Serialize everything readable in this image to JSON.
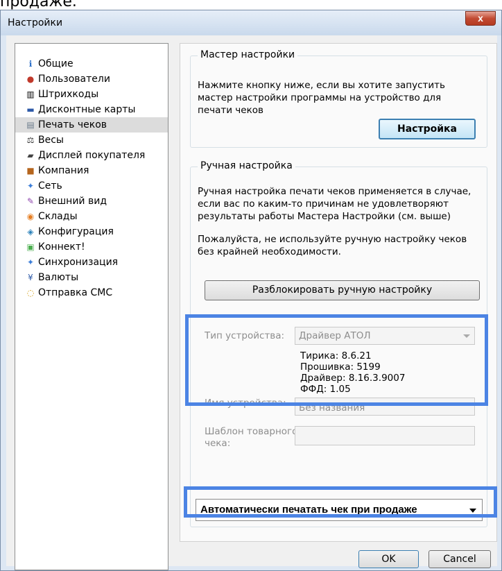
{
  "top_snippet": "продаже.",
  "window": {
    "title": "Настройки",
    "close_label": "x"
  },
  "sidebar": {
    "items": [
      {
        "label": "Общие",
        "icon": "info-icon",
        "glyph": "ℹ",
        "color": "#2a6fc9"
      },
      {
        "label": "Пользователи",
        "icon": "users-icon",
        "glyph": "●",
        "color": "#c0392b"
      },
      {
        "label": "Штрихкоды",
        "icon": "barcode-icon",
        "glyph": "▥",
        "color": "#000000"
      },
      {
        "label": "Дисконтные карты",
        "icon": "card-icon",
        "glyph": "▬",
        "color": "#2e5aa8"
      },
      {
        "label": "Печать чеков",
        "icon": "printer-icon",
        "glyph": "▤",
        "color": "#6a7a8a",
        "selected": true
      },
      {
        "label": "Весы",
        "icon": "scales-icon",
        "glyph": "⚖",
        "color": "#333333"
      },
      {
        "label": "Дисплей покупателя",
        "icon": "display-icon",
        "glyph": "▰",
        "color": "#444444"
      },
      {
        "label": "Компания",
        "icon": "briefcase-icon",
        "glyph": "■",
        "color": "#b5651d"
      },
      {
        "label": "Сеть",
        "icon": "network-icon",
        "glyph": "✦",
        "color": "#3b7dd8"
      },
      {
        "label": "Внешний вид",
        "icon": "brush-icon",
        "glyph": "✎",
        "color": "#8e44ad"
      },
      {
        "label": "Склады",
        "icon": "warehouse-icon",
        "glyph": "◉",
        "color": "#e67e22"
      },
      {
        "label": "Конфигурация",
        "icon": "config-icon",
        "glyph": "◈",
        "color": "#2980b9"
      },
      {
        "label": "Коннект!",
        "icon": "android-icon",
        "glyph": "▣",
        "color": "#4caf50"
      },
      {
        "label": "Синхронизация",
        "icon": "sync-icon",
        "glyph": "✦",
        "color": "#3b7dd8"
      },
      {
        "label": "Валюты",
        "icon": "currency-icon",
        "glyph": "¥",
        "color": "#2e5aa8"
      },
      {
        "label": "Отправка СМС",
        "icon": "sms-icon",
        "glyph": "◌",
        "color": "#d4a017"
      }
    ]
  },
  "wizard": {
    "title": "Мастер настройки",
    "text_lines": [
      "Нажмите кнопку ниже, если вы хотите запустить",
      "мастер настройки программы на устройство для",
      "печати чеков"
    ],
    "button": "Настройка"
  },
  "manual": {
    "title": "Ручная настройка",
    "text1_lines": [
      "Ручная настройка печати чеков применяется в случае,",
      "если вас по каким-то причинам не удовлетворяют",
      "результаты работы Мастера Настройки (см. выше)"
    ],
    "text2_lines": [
      "Пожалуйста, не используйте ручную настройку чеков",
      "без крайней необходимости."
    ],
    "unlock_button": "Разблокировать ручную настройку",
    "device_type_label": "Тип устройства:",
    "device_type_value": "Драйвер АТОЛ",
    "info": [
      "Тирика: 8.6.21",
      "Прошивка: 5199",
      "Драйвер: 8.16.3.9007",
      "ФФД: 1.05"
    ],
    "device_name_label": "Имя устройства:",
    "device_name_value": "Без названия",
    "template_label_lines": [
      "Шаблон товарного",
      "чека:"
    ]
  },
  "auto_print": {
    "value": "Автоматически печатать чек при продаже"
  },
  "footer": {
    "ok": "OK",
    "cancel": "Cancel"
  },
  "colors": {
    "highlight": "#4c84e4"
  }
}
